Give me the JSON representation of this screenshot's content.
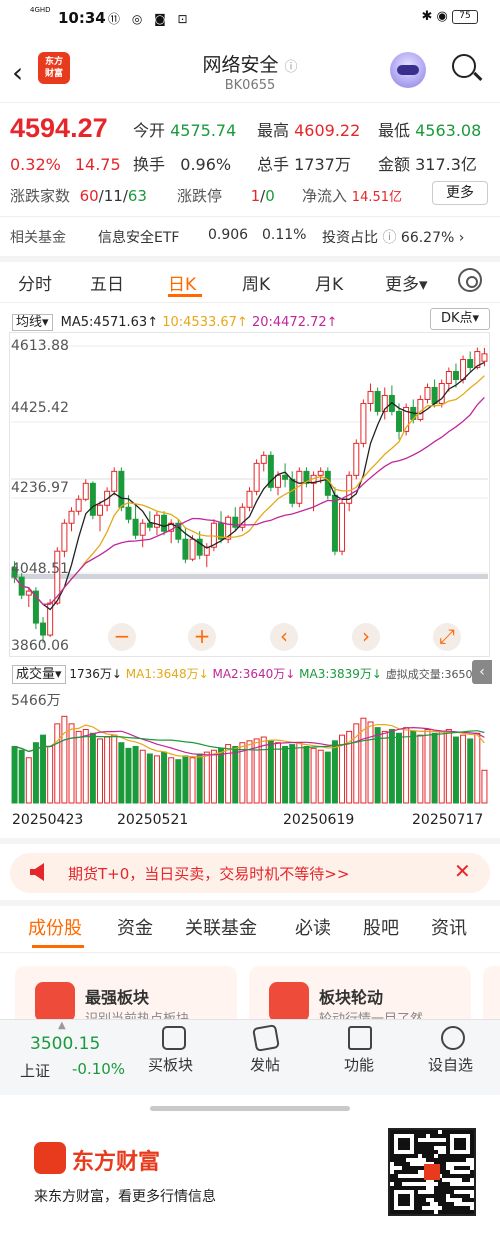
{
  "status": {
    "time": "10:34",
    "net": "4GHD",
    "battery": "75",
    "icons": "⑪ ◎ ◙ ⊡"
  },
  "header": {
    "title": "网络安全",
    "code": "BK0655",
    "logo_text": "东方财富"
  },
  "quote": {
    "price": "4594.27",
    "pct": "0.32%",
    "chg": "14.75",
    "open_label": "今开",
    "open": "4575.74",
    "high_label": "最高",
    "high": "4609.22",
    "low_label": "最低",
    "low": "4563.08",
    "turnover_label": "换手",
    "turnover": "0.96%",
    "vol_label": "总手",
    "vol": "1737万",
    "amount_label": "金额",
    "amount": "317.3亿",
    "breadth_label": "涨跌家数",
    "breadth_up": "60",
    "breadth_flat": "11",
    "breadth_down": "63",
    "limit_label": "涨跌停",
    "limit_up": "1",
    "limit_down": "0",
    "inflow_label": "净流入",
    "inflow": "14.51亿",
    "more": "更多"
  },
  "fund": {
    "label": "相关基金",
    "name": "信息安全ETF",
    "price": "0.906",
    "pct": "0.11%",
    "ratio_label": "投资占比",
    "ratio": "66.27%"
  },
  "tabs": [
    "分时",
    "五日",
    "日K",
    "周K",
    "月K",
    "更多▾"
  ],
  "ma": {
    "selector": "均线▾",
    "ma5": "MA5:4571.63↑",
    "ma10": "10:4533.67↑",
    "ma20": "20:4472.72↑",
    "dk": "DK点▾"
  },
  "yaxis": [
    "4613.88",
    "4425.42",
    "4236.97",
    "4048.51",
    "3860.06"
  ],
  "controls": [
    "−",
    "+",
    "‹",
    "›",
    "⤢"
  ],
  "volume": {
    "selector": "成交量▾",
    "value": "1736万↓",
    "ma1": "MA1:3648万↓",
    "ma2": "MA2:3640万↓",
    "ma3": "MA3:3839万↓",
    "virtual": "虚拟成交量:3650万",
    "ymax": "5466万"
  },
  "xaxis": [
    "20250423",
    "20250521",
    "20250619",
    "20250717"
  ],
  "banner": {
    "text": "期货T+0，当日买卖，交易时机不等待>>"
  },
  "tabs2": [
    "成份股",
    "资金",
    "关联基金",
    "必读",
    "股吧",
    "资讯"
  ],
  "cards": [
    {
      "title": "最强板块",
      "sub": "识别当前热点板块"
    },
    {
      "title": "板块轮动",
      "sub": "轮动行情一目了然"
    }
  ],
  "bottom": {
    "index_value": "3500.15",
    "index_name": "上证",
    "index_pct": "-0.10%",
    "items": [
      "买板块",
      "发帖",
      "功能",
      "设自选"
    ]
  },
  "ad": {
    "name": "东方财富",
    "text": "来东方财富，看更多行情信息"
  },
  "chart_data": {
    "type": "candlestick",
    "ylim": [
      3860.06,
      4613.88
    ],
    "yticks": [
      4613.88,
      4425.42,
      4236.97,
      4048.51,
      3860.06
    ],
    "xticks": [
      "20250423",
      "20250521",
      "20250619",
      "20250717"
    ],
    "candles": [
      [
        4060,
        4075,
        4020,
        4035
      ],
      [
        4035,
        4045,
        3980,
        3990
      ],
      [
        3990,
        4010,
        3960,
        4000
      ],
      [
        4000,
        4010,
        3905,
        3920
      ],
      [
        3920,
        3935,
        3870,
        3890
      ],
      [
        3890,
        3980,
        3885,
        3970
      ],
      [
        3970,
        4110,
        3965,
        4100
      ],
      [
        4100,
        4180,
        4085,
        4170
      ],
      [
        4170,
        4210,
        4150,
        4200
      ],
      [
        4200,
        4240,
        4190,
        4230
      ],
      [
        4230,
        4280,
        4225,
        4270
      ],
      [
        4270,
        4275,
        4180,
        4190
      ],
      [
        4190,
        4225,
        4150,
        4215
      ],
      [
        4215,
        4260,
        4200,
        4250
      ],
      [
        4250,
        4310,
        4240,
        4300
      ],
      [
        4300,
        4310,
        4200,
        4210
      ],
      [
        4210,
        4240,
        4170,
        4180
      ],
      [
        4180,
        4220,
        4130,
        4140
      ],
      [
        4140,
        4180,
        4110,
        4170
      ],
      [
        4170,
        4200,
        4150,
        4160
      ],
      [
        4160,
        4200,
        4140,
        4190
      ],
      [
        4190,
        4200,
        4140,
        4150
      ],
      [
        4150,
        4180,
        4120,
        4170
      ],
      [
        4170,
        4180,
        4120,
        4130
      ],
      [
        4130,
        4160,
        4070,
        4080
      ],
      [
        4080,
        4140,
        4075,
        4130
      ],
      [
        4130,
        4150,
        4080,
        4090
      ],
      [
        4090,
        4120,
        4060,
        4110
      ],
      [
        4110,
        4180,
        4100,
        4170
      ],
      [
        4170,
        4200,
        4120,
        4130
      ],
      [
        4130,
        4190,
        4120,
        4185
      ],
      [
        4185,
        4210,
        4150,
        4160
      ],
      [
        4160,
        4220,
        4150,
        4210
      ],
      [
        4210,
        4260,
        4200,
        4250
      ],
      [
        4250,
        4330,
        4240,
        4320
      ],
      [
        4320,
        4350,
        4300,
        4340
      ],
      [
        4340,
        4350,
        4250,
        4260
      ],
      [
        4260,
        4300,
        4240,
        4290
      ],
      [
        4290,
        4320,
        4260,
        4280
      ],
      [
        4280,
        4300,
        4210,
        4220
      ],
      [
        4220,
        4310,
        4210,
        4300
      ],
      [
        4300,
        4310,
        4260,
        4270
      ],
      [
        4270,
        4300,
        4200,
        4290
      ],
      [
        4290,
        4310,
        4270,
        4300
      ],
      [
        4300,
        4310,
        4230,
        4240
      ],
      [
        4240,
        4260,
        4090,
        4100
      ],
      [
        4100,
        4230,
        4090,
        4220
      ],
      [
        4220,
        4300,
        4200,
        4290
      ],
      [
        4290,
        4380,
        4280,
        4370
      ],
      [
        4370,
        4480,
        4360,
        4470
      ],
      [
        4470,
        4520,
        4450,
        4500
      ],
      [
        4500,
        4510,
        4440,
        4450
      ],
      [
        4450,
        4510,
        4430,
        4490
      ],
      [
        4490,
        4515,
        4440,
        4450
      ],
      [
        4450,
        4470,
        4380,
        4400
      ],
      [
        4400,
        4470,
        4390,
        4460
      ],
      [
        4460,
        4480,
        4420,
        4430
      ],
      [
        4430,
        4490,
        4425,
        4480
      ],
      [
        4480,
        4520,
        4470,
        4510
      ],
      [
        4510,
        4530,
        4460,
        4470
      ],
      [
        4470,
        4530,
        4460,
        4520
      ],
      [
        4520,
        4560,
        4500,
        4550
      ],
      [
        4550,
        4570,
        4510,
        4530
      ],
      [
        4530,
        4590,
        4520,
        4580
      ],
      [
        4580,
        4600,
        4550,
        4560
      ],
      [
        4560,
        4610,
        4555,
        4600
      ],
      [
        4575.74,
        4609.22,
        4563.08,
        4594.27
      ]
    ],
    "volume_max": 5466,
    "volumes": [
      3000,
      2800,
      2400,
      3200,
      3600,
      3000,
      4200,
      4600,
      4200,
      3800,
      3900,
      3700,
      3400,
      3500,
      3600,
      3200,
      2900,
      3000,
      2800,
      2600,
      2500,
      2700,
      2400,
      2300,
      2500,
      2400,
      2600,
      2700,
      2800,
      2900,
      3100,
      3000,
      3200,
      3300,
      3400,
      3500,
      3300,
      3200,
      3000,
      3100,
      3200,
      3000,
      2900,
      2800,
      2700,
      3300,
      3600,
      3800,
      4200,
      4500,
      4300,
      4000,
      3800,
      3900,
      3700,
      4000,
      3800,
      3600,
      3900,
      3700,
      3800,
      3900,
      3500,
      3600,
      3400,
      3700,
      1736
    ],
    "ma": [
      "MA5",
      "MA10",
      "MA20"
    ]
  }
}
